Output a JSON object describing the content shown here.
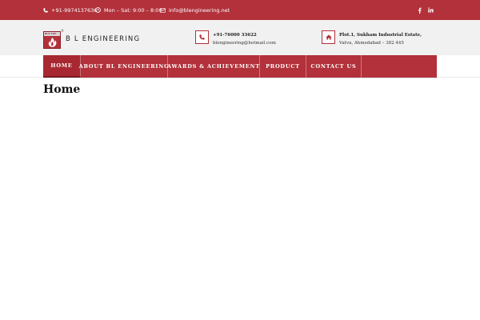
{
  "topbar": {
    "phone": "+91-9974137636",
    "hours": "Mon – Sat: 9:00 – 8:00",
    "email": "info@blengineering.net",
    "social": [
      "facebook-icon",
      "linkedin-icon"
    ]
  },
  "header": {
    "logo_band_text": "BLU·TOP",
    "registered_mark": "®",
    "brand": "B L ENGINEERING",
    "contact": {
      "phone": "+91-76000 33622",
      "email": "blengineering@hotmail.com"
    },
    "address": {
      "line1": "Plot.1, Sukham Industrial Estate,",
      "line2": "Vatva, Ahmedabad – 382 445"
    }
  },
  "nav": {
    "items": [
      "HOME",
      "ABOUT BL ENGINEERING",
      "AWARDS & ACHIEVEMENT",
      "PRODUCT",
      "CONTACT US"
    ],
    "active": "HOME"
  },
  "page": {
    "title": "Home"
  },
  "colors": {
    "brand_red": "#b2313a",
    "header_bg": "#f1f1f1"
  }
}
